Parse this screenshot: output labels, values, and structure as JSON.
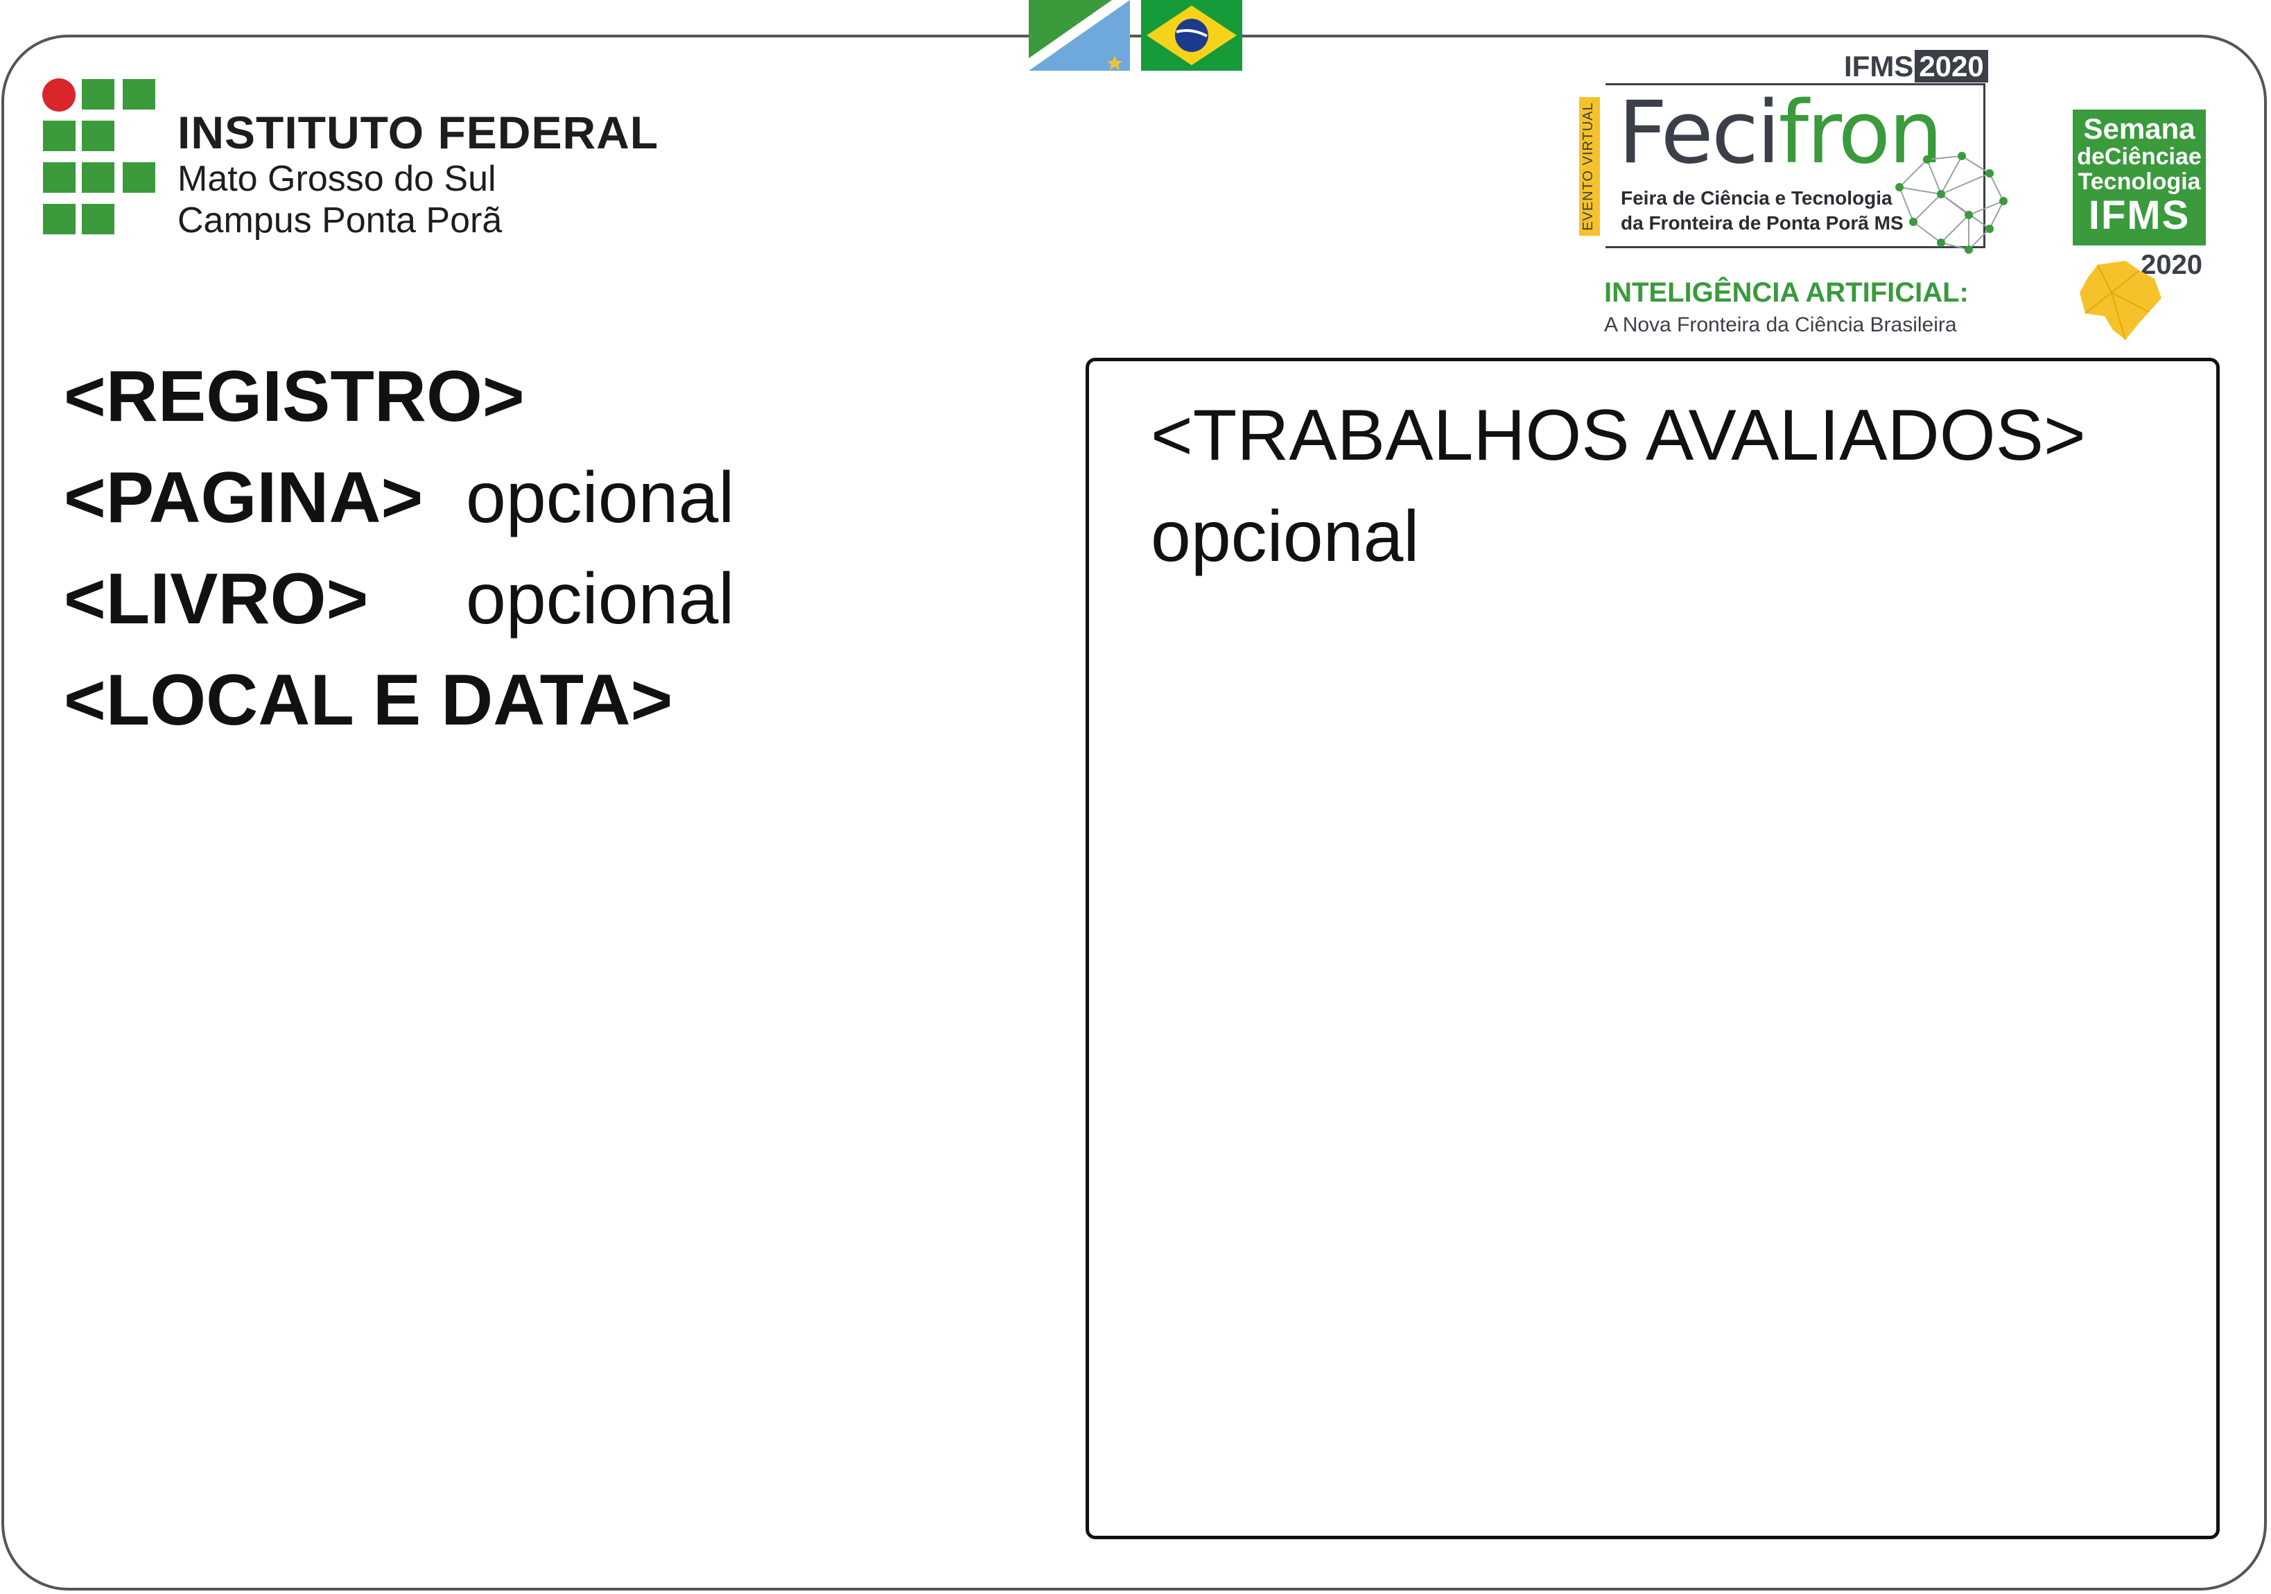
{
  "colors": {
    "green": "#3a9a3c",
    "red": "#d9262b",
    "dark": "#3b3f47",
    "yellow": "#f6c22b",
    "frame": "#555555"
  },
  "header": {
    "institute": {
      "title": "INSTITUTO FEDERAL",
      "line1": "Mato Grosso do Sul",
      "line2": "Campus Ponta Porã"
    },
    "flags": [
      "ms-flag-icon",
      "brazil-flag-icon"
    ],
    "fecifron": {
      "ifms": "IFMS",
      "year_badge": "2020",
      "evento": "EVENTO VIRTUAL",
      "name_part1": "Feci",
      "name_part2": "fron",
      "subtitle1": "Feira de Ciência e Tecnologia",
      "subtitle2": "da Fronteira de Ponta Porã MS",
      "theme_title": "INTELIGÊNCIA ARTIFICIAL:",
      "theme_subtitle": "A Nova Fronteira da Ciência Brasileira"
    },
    "semana": {
      "line1": "Semana",
      "line2": "deCiênciae",
      "line3": "Tecnologia",
      "line4": "IFMS",
      "year": "2020"
    }
  },
  "fields": {
    "registro": "<REGISTRO>",
    "pagina": "<PAGINA>",
    "pagina_opt": "opcional",
    "livro": "<LIVRO>",
    "livro_opt": "opcional",
    "local_data": "<LOCAL E DATA>"
  },
  "trabalhos": {
    "title": "<TRABALHOS AVALIADOS>",
    "opt": "opcional"
  }
}
